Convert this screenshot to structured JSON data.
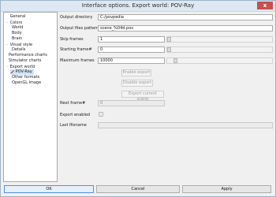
{
  "window": {
    "title": "Interface options. Export world: POV-Ray",
    "close_label": "x"
  },
  "tree": {
    "items": [
      {
        "label": "General",
        "expander": ""
      },
      {
        "label": "Colors",
        "expander": "-"
      },
      {
        "label": "World",
        "expander": ""
      },
      {
        "label": "Body",
        "expander": ""
      },
      {
        "label": "Brain",
        "expander": ""
      },
      {
        "label": "Visual style",
        "expander": "-"
      },
      {
        "label": "Details",
        "expander": ""
      },
      {
        "label": "Performance charts",
        "expander": ""
      },
      {
        "label": "Simulator charts",
        "expander": ""
      },
      {
        "label": "Export world",
        "expander": "-"
      },
      {
        "label": "POV-Ray",
        "expander": ""
      },
      {
        "label": "Other formats",
        "expander": ""
      },
      {
        "label": "OpenGL image",
        "expander": ""
      }
    ]
  },
  "form": {
    "output_directory": {
      "label": "Output directory",
      "value": "C:/povpedia"
    },
    "output_files_pattern": {
      "label": "Output files pattern",
      "value": "scene_%04d.pov"
    },
    "skip_frames": {
      "label": "Skip frames",
      "value": "1"
    },
    "starting_frame": {
      "label": "Starting frame#",
      "value": "0"
    },
    "maximum_frames": {
      "label": "Maximum frames",
      "value": "10000"
    },
    "enable_export_label": "Enable export",
    "disable_export_label": "Disable export",
    "export_current_scene_label": "Export current scene",
    "next_frame": {
      "label": "Next frame#",
      "value": "0"
    },
    "export_enabled": {
      "label": "Export enabled",
      "checked": false
    },
    "last_filename": {
      "label": "Last filename",
      "value": ""
    }
  },
  "buttons": {
    "ok": "OK",
    "cancel": "Cancel",
    "apply": "Apply"
  }
}
